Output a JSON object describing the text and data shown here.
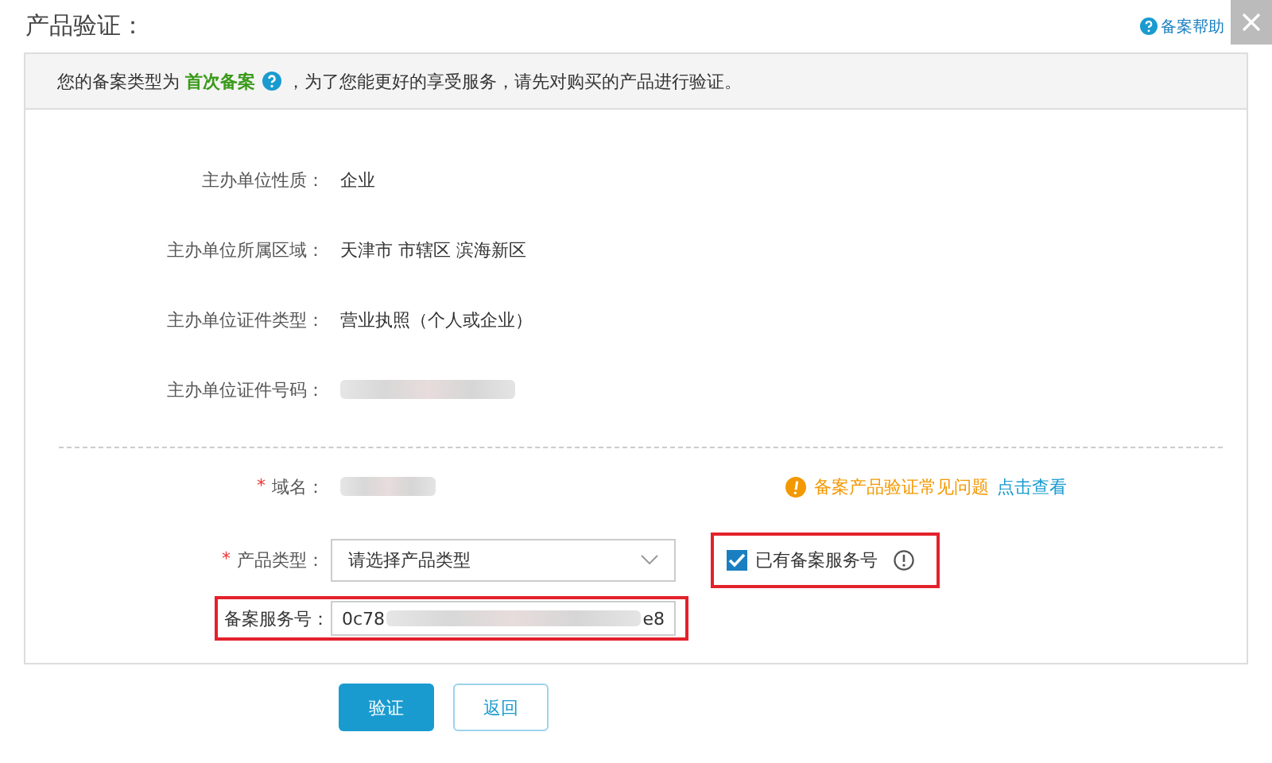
{
  "title": "产品验证：",
  "help_link": "备案帮助",
  "notice": {
    "prefix": "您的备案类型为",
    "type": "首次备案",
    "suffix": "，为了您能更好的享受服务，请先对购买的产品进行验证。"
  },
  "info_rows": [
    {
      "label": "主办单位性质：",
      "value": "企业"
    },
    {
      "label": "主办单位所属区域：",
      "value": "天津市 市辖区 滨海新区"
    },
    {
      "label": "主办单位证件类型：",
      "value": "营业执照（个人或企业）"
    },
    {
      "label": "主办单位证件号码：",
      "redacted": true
    }
  ],
  "domain": {
    "label": "域名：",
    "required_mark": "*",
    "redacted": true
  },
  "faq": {
    "text": "备案产品验证常见问题",
    "link": "点击查看"
  },
  "product_type": {
    "label": "产品类型：",
    "required_mark": "*",
    "placeholder": "请选择产品类型"
  },
  "has_service_number": {
    "label": "已有备案服务号",
    "checked": true
  },
  "service_number": {
    "label": "备案服务号：",
    "value_start": "0c78",
    "value_end": "e8"
  },
  "buttons": [
    {
      "label": "验证",
      "kind": "primary"
    },
    {
      "label": "返回",
      "kind": "secondary"
    }
  ]
}
